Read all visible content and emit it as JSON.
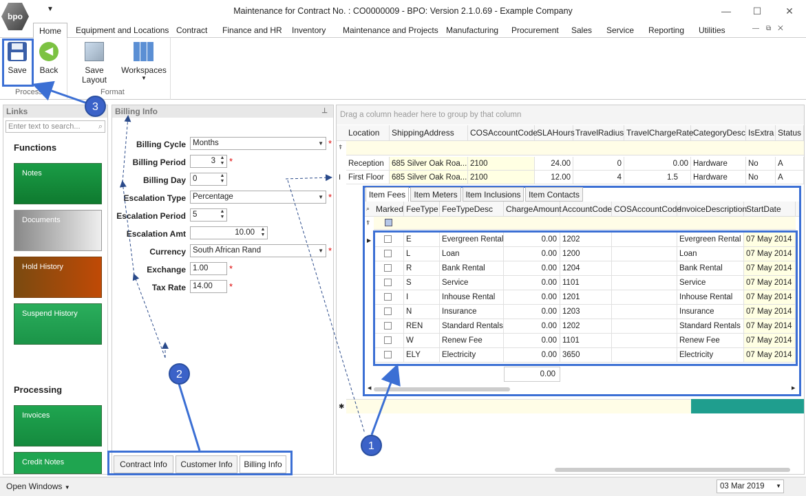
{
  "app": {
    "logo_text": "bpo",
    "title": "Maintenance for Contract No. : CO0000009 - BPO: Version 2.1.0.69 - Example Company",
    "qat_icon": "dropdown-arrow-icon"
  },
  "menu": {
    "tabs": [
      "Home",
      "Equipment and Locations",
      "Contract",
      "Finance and HR",
      "Inventory",
      "Maintenance and Projects",
      "Manufacturing",
      "Procurement",
      "Sales",
      "Service",
      "Reporting",
      "Utilities"
    ]
  },
  "ribbon": {
    "save": "Save",
    "back": "Back",
    "save_layout": "Save Layout",
    "workspaces": "Workspaces",
    "group_process": "Process",
    "group_format": "Format"
  },
  "links": {
    "title": "Links",
    "search_placeholder": "Enter text to search...",
    "functions": "Functions",
    "processing": "Processing",
    "tiles": [
      "Notes",
      "Documents",
      "Hold History",
      "Suspend History"
    ],
    "processing_tiles": [
      "Invoices",
      "Credit Notes"
    ]
  },
  "billing": {
    "title": "Billing Info",
    "labels": [
      "Billing Cycle",
      "Billing Period",
      "Billing Day",
      "Escalation Type",
      "Escalation Period",
      "Escalation Amt",
      "Currency",
      "Exchange",
      "Tax Rate"
    ],
    "billing_cycle": "Months",
    "billing_period": "3",
    "billing_day": "0",
    "escalation_type": "Percentage",
    "escalation_period": "5",
    "escalation_amt": "10.00",
    "currency": "South African Rand",
    "exchange": "1.00",
    "tax_rate": "14.00"
  },
  "bottom_tabs": [
    "Contract Info",
    "Customer Info",
    "Billing Info"
  ],
  "grid": {
    "group_hint": "Drag a column header here to group by that column",
    "columns": [
      "Location",
      "ShippingAddress",
      "COSAccountCode",
      "SLAHours",
      "TravelRadius",
      "TravelChargeRate",
      "CategoryDesc",
      "IsExtra",
      "Status"
    ],
    "rows": [
      [
        "Reception",
        "685 Silver Oak Roa...",
        "2100",
        "24.00",
        "0",
        "0.00",
        "Hardware",
        "No",
        "A"
      ],
      [
        "First Floor",
        "685 Silver Oak Roa...",
        "2100",
        "12.00",
        "4",
        "1.5",
        "Hardware",
        "No",
        "A"
      ]
    ]
  },
  "subgrid": {
    "tabs": [
      "Item Fees",
      "Item Meters",
      "Item Inclusions",
      "Item Contacts"
    ],
    "columns": [
      "Marked",
      "FeeType",
      "FeeTypeDesc",
      "ChargeAmount",
      "AccountCode",
      "COSAccountCode",
      "InvoiceDescription",
      "StartDate"
    ],
    "rows": [
      [
        "E",
        "Evergreen Rental",
        "0.00",
        "1202",
        "",
        "Evergreen Rental",
        "07 May 2014"
      ],
      [
        "L",
        "Loan",
        "0.00",
        "1200",
        "",
        "Loan",
        "07 May 2014"
      ],
      [
        "R",
        "Bank Rental",
        "0.00",
        "1204",
        "",
        "Bank Rental",
        "07 May 2014"
      ],
      [
        "S",
        "Service",
        "0.00",
        "1101",
        "",
        "Service",
        "07 May 2014"
      ],
      [
        "I",
        "Inhouse Rental",
        "0.00",
        "1201",
        "",
        "Inhouse Rental",
        "07 May 2014"
      ],
      [
        "N",
        "Insurance",
        "0.00",
        "1203",
        "",
        "Insurance",
        "07 May 2014"
      ],
      [
        "REN",
        "Standard Rentals",
        "0.00",
        "1202",
        "",
        "Standard Rentals",
        "07 May 2014"
      ],
      [
        "W",
        "Renew Fee",
        "0.00",
        "1101",
        "",
        "Renew Fee",
        "07 May 2014"
      ],
      [
        "ELY",
        "Electricity",
        "0.00",
        "3650",
        "",
        "Electricity",
        "07 May 2014"
      ]
    ],
    "total": "0.00"
  },
  "status": {
    "open_windows": "Open Windows",
    "date": "03 Mar 2019"
  },
  "callouts": [
    "1",
    "2",
    "3"
  ],
  "colors": {
    "accent": "#3b6fd4",
    "green_tile": "#1e9e4a",
    "brown_tile": "#b0400b"
  }
}
